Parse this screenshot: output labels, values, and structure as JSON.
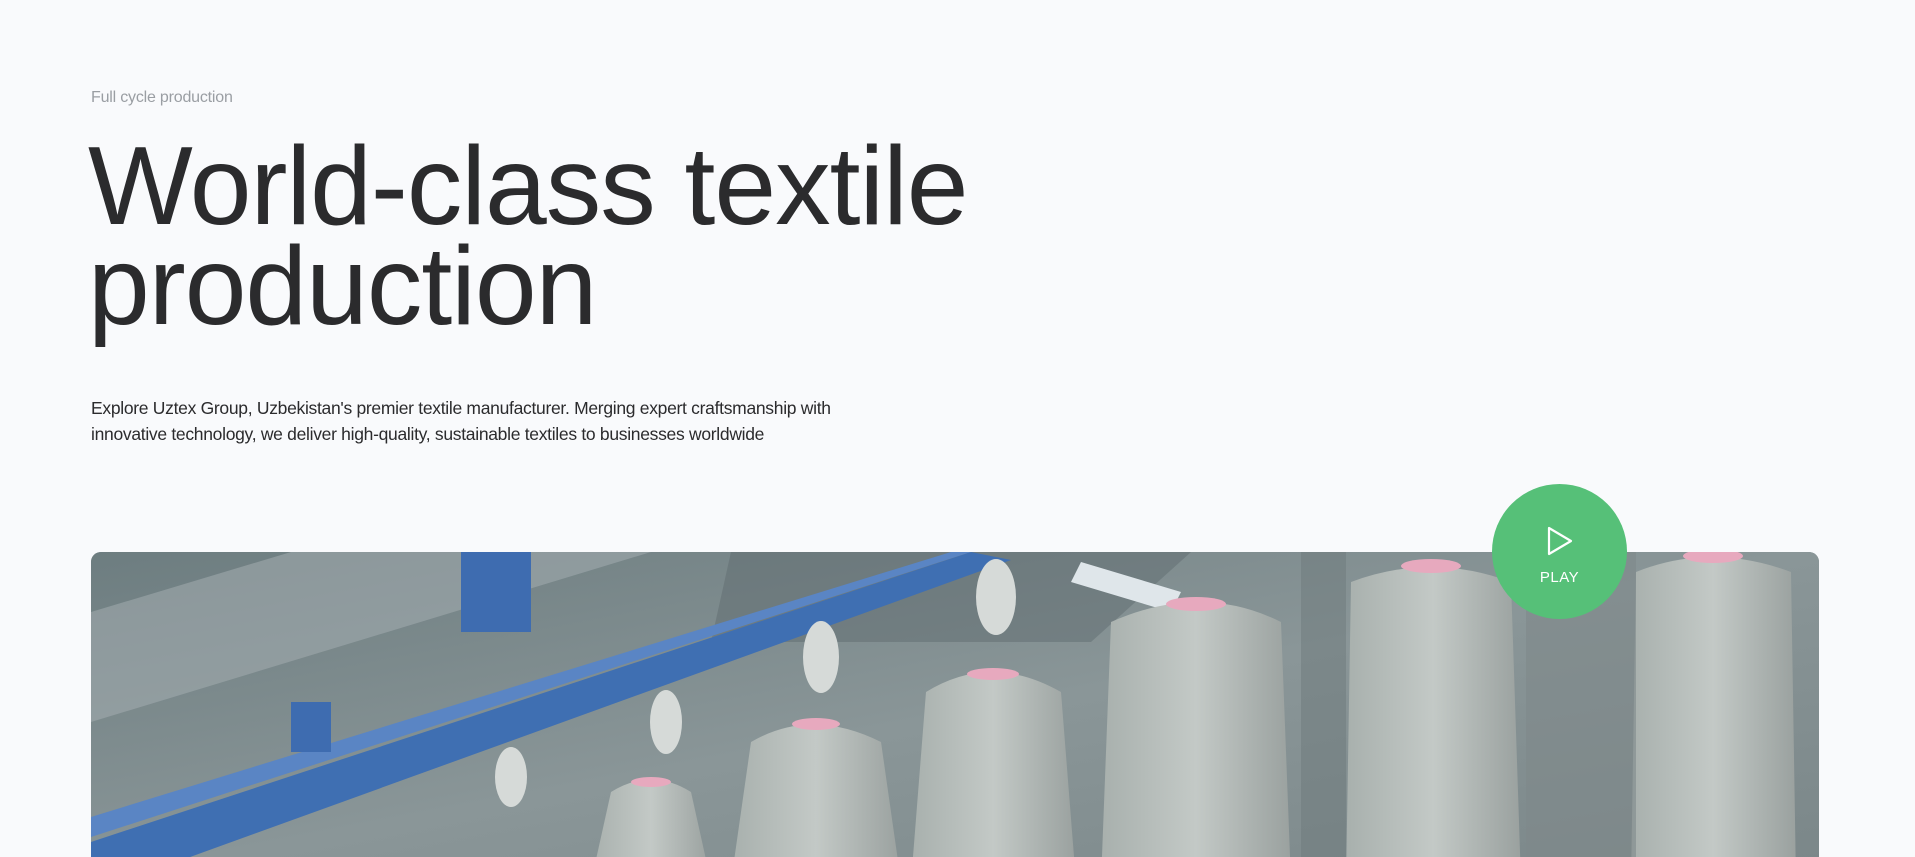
{
  "hero": {
    "eyebrow": "Full cycle production",
    "title_line1": "World-class textile",
    "title_line2": "production",
    "description": "Explore Uztex Group, Uzbekistan's premier textile manufacturer. Merging expert craftsmanship with innovative technology, we deliver high-quality, sustainable textiles to businesses worldwide"
  },
  "video": {
    "play_label": "PLAY",
    "play_icon": "play-icon"
  },
  "colors": {
    "background": "#f9fafc",
    "text": "#2b2b2d",
    "muted": "#9a9ea3",
    "accent": "#56c078"
  }
}
